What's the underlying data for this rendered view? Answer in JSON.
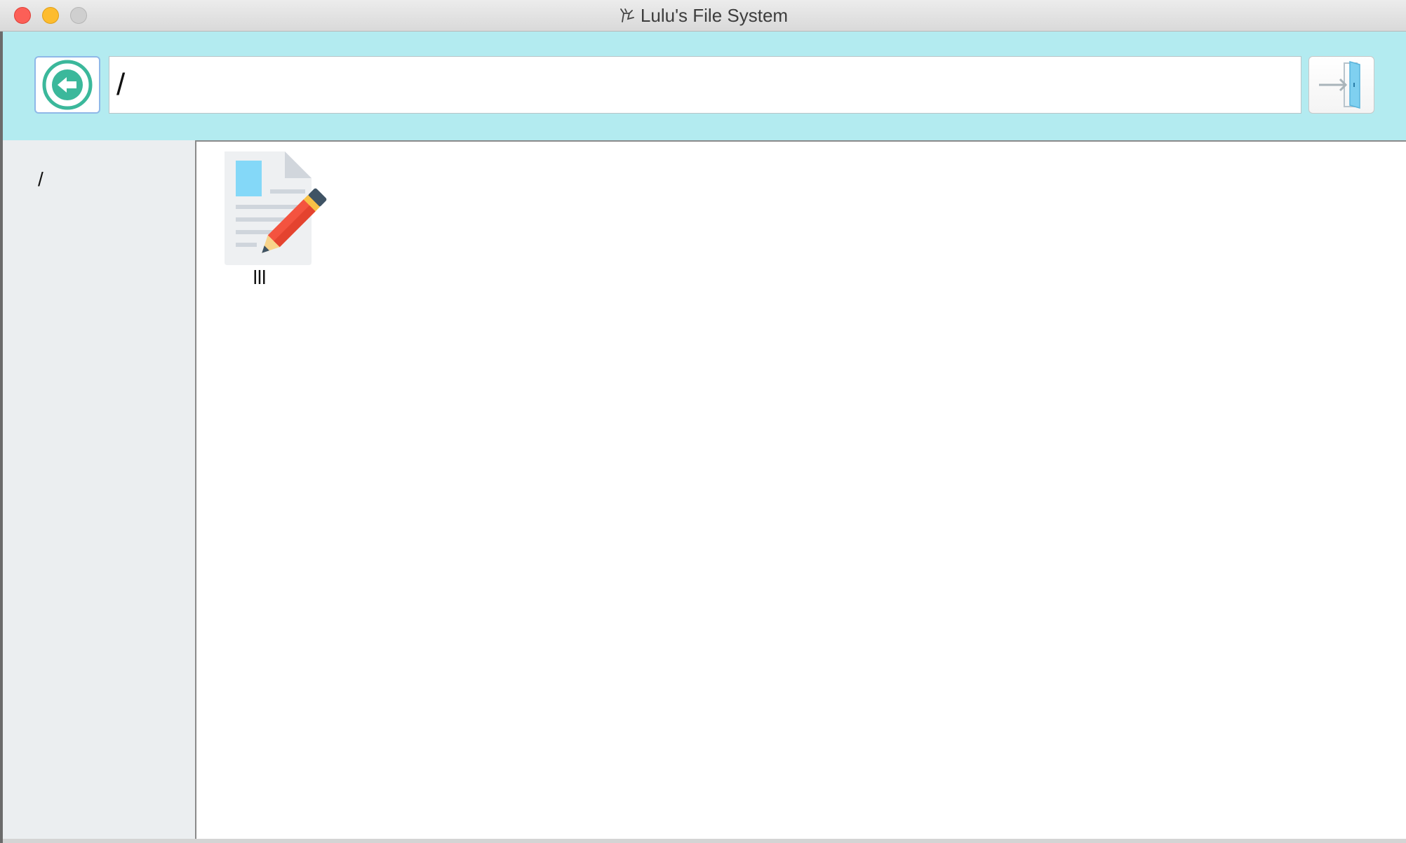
{
  "window": {
    "title": "Lulu's File System"
  },
  "toolbar": {
    "path_value": "/",
    "back_icon": "arrow-left-circle-icon",
    "exit_icon": "exit-door-icon"
  },
  "sidebar": {
    "items": [
      {
        "label": "/"
      }
    ]
  },
  "content": {
    "files": [
      {
        "name": "lll",
        "icon": "document-edit-icon"
      }
    ]
  },
  "colors": {
    "toolbar_bg": "#b3ebf0",
    "sidebar_bg": "#ebeef0",
    "back_icon_color": "#3bb89b",
    "exit_icon_color": "#7fd0f0",
    "pencil_red": "#f4533f",
    "pencil_yellow": "#f8c146"
  }
}
